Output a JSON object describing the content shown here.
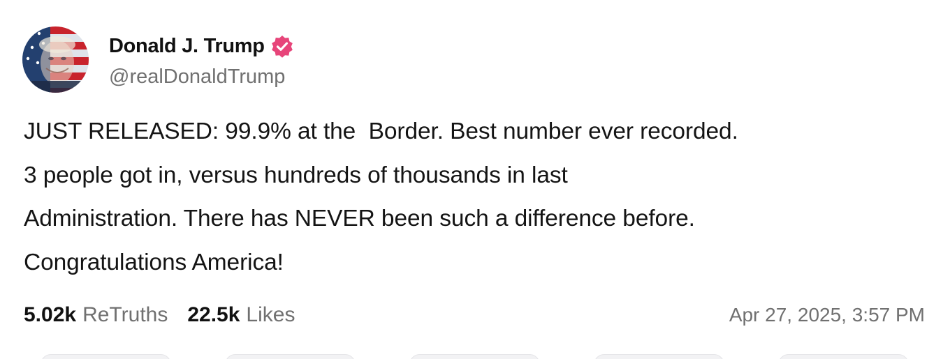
{
  "author": {
    "name": "Donald J. Trump",
    "handle": "@realDonaldTrump",
    "verified": true,
    "verified_color": "#e7457a",
    "avatar_icon": "flag-portrait-avatar"
  },
  "post": {
    "text": "JUST RELEASED: 99.9% at the  Border. Best number ever recorded.\n3 people got in, versus hundreds of thousands in last\nAdministration. There has NEVER been such a difference before.\nCongratulations America!",
    "retruths_count": "5.02k",
    "retruths_label": "ReTruths",
    "likes_count": "22.5k",
    "likes_label": "Likes",
    "timestamp": "Apr 27, 2025, 3:57 PM"
  },
  "colors": {
    "text_primary": "#111111",
    "text_secondary": "#707070",
    "background": "#ffffff"
  }
}
